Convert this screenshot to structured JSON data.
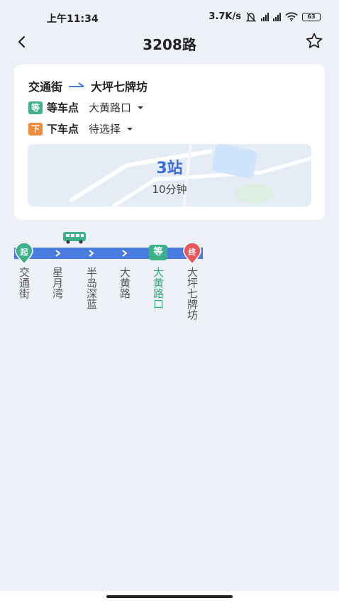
{
  "status_bar": {
    "time": "上午11:34",
    "speed": "3.7K/s",
    "battery": "63"
  },
  "header": {
    "title": "3208路"
  },
  "card": {
    "from": "交通街",
    "to": "大坪七牌坊",
    "board": {
      "tag": "等",
      "label": "等车点",
      "value": "大黄路口"
    },
    "alight": {
      "tag": "下",
      "label": "下车点",
      "value": "待选择"
    },
    "stations_away": "3站",
    "eta": "10分钟"
  },
  "line": {
    "start_tag": "起",
    "end_tag": "终",
    "wait_tag": "等",
    "stations": [
      "交通街",
      "星月湾",
      "半岛深蓝",
      "大黄路",
      "大黄路口",
      "大坪七牌坊"
    ],
    "current_index": 4
  },
  "colors": {
    "accent_blue": "#4a7be0",
    "wait_green": "#3cb18a",
    "alight_orange": "#f08a3c",
    "end_red": "#e8575a"
  }
}
